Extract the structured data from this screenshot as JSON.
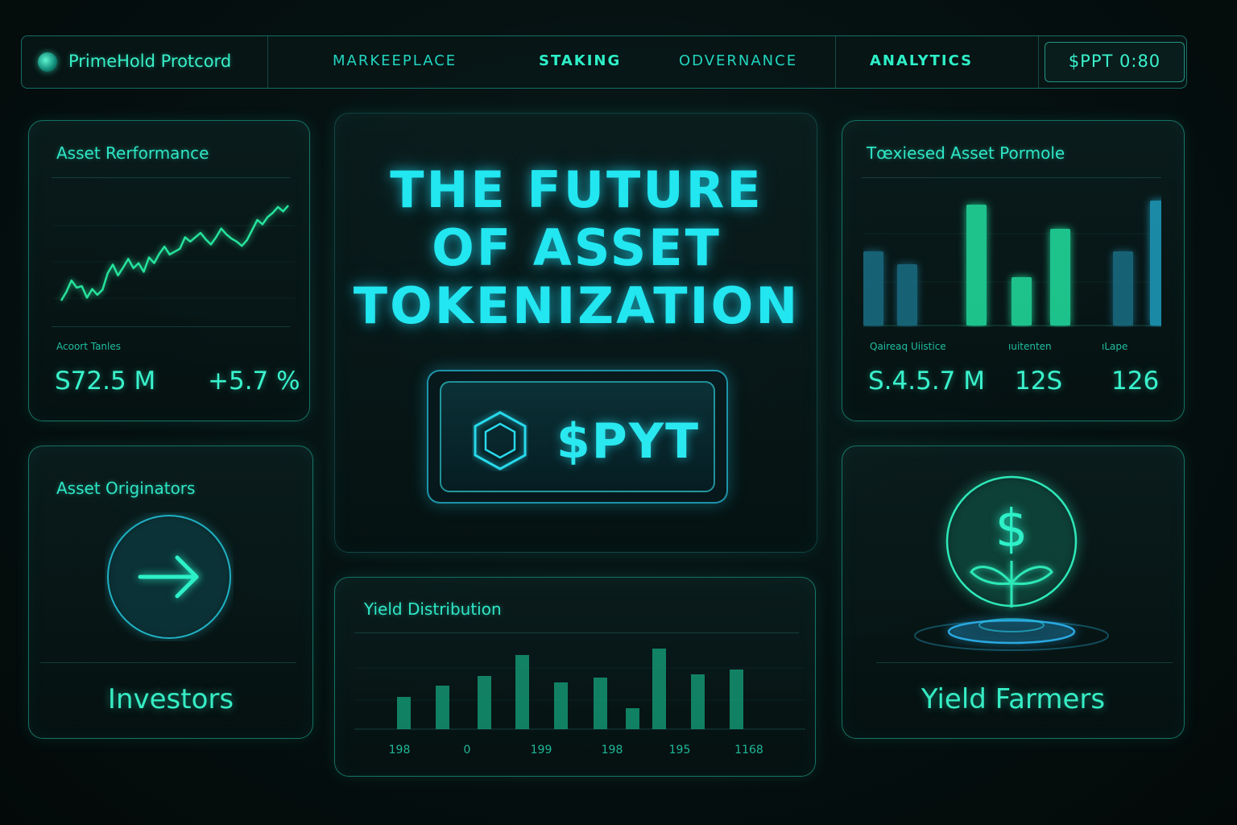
{
  "nav": {
    "brand": "PrimeHold Protcord",
    "items": [
      {
        "label": "MARKEEPLACE"
      },
      {
        "label": "STAKING"
      },
      {
        "label": "ODVERNANCE"
      },
      {
        "label": "ANALYTICS"
      }
    ],
    "price": "$PPT 0:80"
  },
  "performance": {
    "title": "Asset Rerformance",
    "sublabel": "Acoort Tanles",
    "value": "S72.5 M",
    "change": "+5.7 %",
    "sparkline": [
      10,
      22,
      38,
      28,
      30,
      14,
      26,
      18,
      25,
      48,
      60,
      45,
      56,
      68,
      55,
      62,
      50,
      70,
      62,
      75,
      85,
      74,
      78,
      82,
      98,
      92,
      98,
      104,
      95,
      88,
      98,
      110,
      102,
      96,
      92,
      86,
      94,
      108,
      122,
      116,
      126,
      132,
      140,
      134,
      142
    ]
  },
  "hero": {
    "lines": [
      "THE FUTURE",
      "OF ASSET",
      "TOKENIZATION"
    ],
    "token": "$PYT"
  },
  "portfolio": {
    "title": "Tœxiesed Asset Pormole",
    "stats": [
      {
        "label": "Qaireaq Uiistice",
        "value": "S.4.5.7 M"
      },
      {
        "label": "ıuitenten",
        "value": "12S"
      },
      {
        "label": "ıLape",
        "value": "126"
      }
    ],
    "chart_data": {
      "type": "bar",
      "values": [
        92,
        76,
        150,
        60,
        120,
        92,
        155
      ],
      "colors": [
        "#1a6f86",
        "#1a6f86",
        "#22e0a0",
        "#22e0a0",
        "#22e0a0",
        "#1a6f86",
        "#1e9ec0"
      ]
    }
  },
  "originators": {
    "title": "Asset Originators",
    "caption": "Investors"
  },
  "yield": {
    "title": "Yield Distribution",
    "chart_data": {
      "type": "bar",
      "values": [
        40,
        54,
        66,
        92,
        58,
        64,
        26,
        100,
        68,
        74
      ],
      "tick_labels": [
        "198",
        "0",
        "199",
        "198",
        "195",
        "1168"
      ]
    }
  },
  "farmers": {
    "caption": "Yield Farmers"
  }
}
